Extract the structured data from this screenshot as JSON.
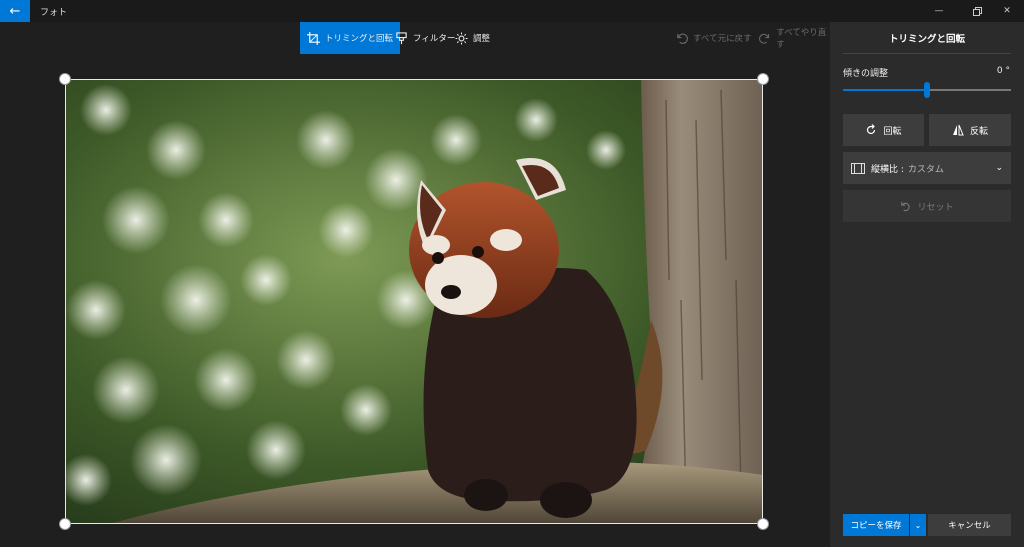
{
  "app": {
    "title": "フォト"
  },
  "toolbar": {
    "crop_rotate": "トリミングと回転",
    "filter": "フィルター",
    "adjust": "調整",
    "undo_all": "すべて元に戻す",
    "redo_all": "すべてやり直す"
  },
  "panel": {
    "title": "トリミングと回転",
    "tilt_label": "傾きの調整",
    "tilt_value": "0 °",
    "tilt_fraction": 0.5,
    "rotate": "回転",
    "flip": "反転",
    "aspect_label": "縦横比 :",
    "aspect_value": "カスタム",
    "reset": "リセット",
    "save_copy": "コピーを保存",
    "cancel": "キャンセル"
  },
  "colors": {
    "accent": "#0078d7"
  }
}
